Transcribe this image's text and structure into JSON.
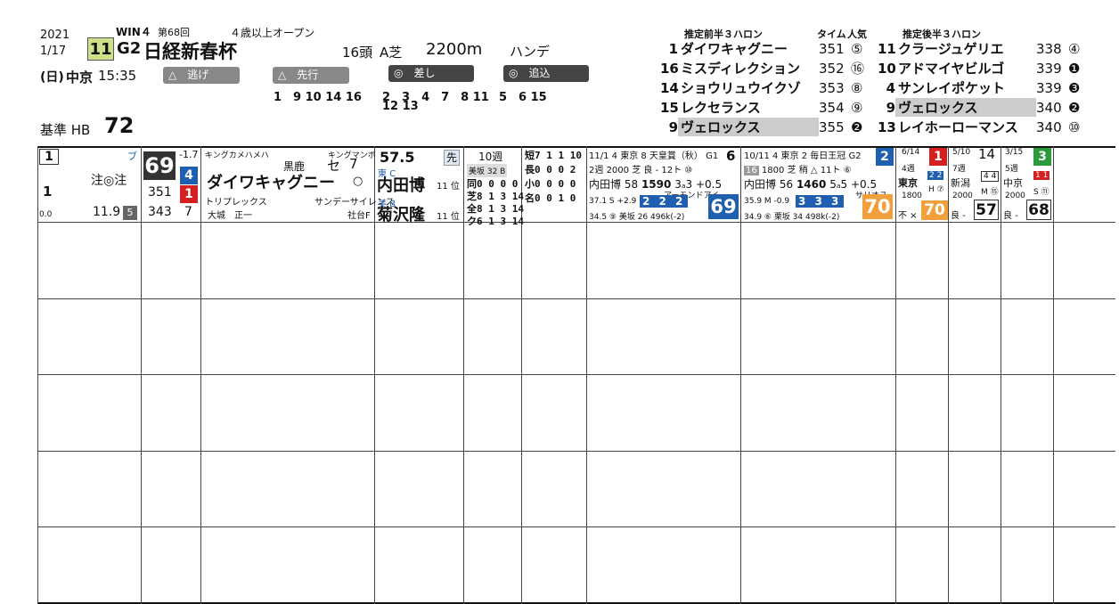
{
  "race": {
    "year": "2021",
    "date": "1/17",
    "weekday": "(日)",
    "venue": "中京",
    "time": "15:35",
    "win": "WIN４",
    "kai": "第68回",
    "race_no": "11",
    "grade": "G2",
    "name": "日経新春杯",
    "cond": "４歳以上オープン",
    "heads": "16頭",
    "course": "A芝",
    "distance": "2200m",
    "handicap": "ハンデ",
    "base_label": "基準 HB",
    "base_value": "72"
  },
  "pace": {
    "labels": [
      "△　逃げ",
      "△　先行",
      "◎　差し",
      "◎　追込"
    ],
    "nige": "1　9 10 14 16",
    "senko1": "2　3　4　7　8 11",
    "senko2": "12 13",
    "sashi": "5　6 15"
  },
  "front3f": {
    "title": "推定前半３ハロン",
    "time_label": "タイム",
    "ninki_label": "人気",
    "rows": [
      [
        "1",
        "ダイワキャグニー",
        "351",
        "⑤"
      ],
      [
        "16",
        "ミスディレクション",
        "352",
        "⑯"
      ],
      [
        "14",
        "ショウリュウイクゾ",
        "353",
        "⑧"
      ],
      [
        "15",
        "レクセランス",
        "354",
        "⑨"
      ],
      [
        "9",
        "ヴェロックス",
        "355",
        "❷"
      ]
    ]
  },
  "back3f": {
    "title": "推定後半３ハロン",
    "rows": [
      [
        "11",
        "クラージュゲリエ",
        "338",
        "④"
      ],
      [
        "10",
        "アドマイヤビルゴ",
        "339",
        "❶"
      ],
      [
        "4",
        "サンレイポケット",
        "339",
        "❸"
      ],
      [
        "9",
        "ヴェロックス",
        "340",
        "❷"
      ],
      [
        "13",
        "レイホーローマンス",
        "340",
        "⑩"
      ]
    ]
  },
  "entry1": {
    "waku": "1",
    "umaban": "1",
    "marks": "注◎注",
    "odds": "11.9",
    "pop": "5",
    "points": "0.0",
    "bu": "ブ",
    "index": "69",
    "idx_diff": "-1.7",
    "idx_sub1": "4",
    "idx_sub2": "1",
    "idx_a": "351",
    "idx_b": "343",
    "idx_rank": "7",
    "sire": "キングカメハメハ",
    "broodsire": "キングマンボ",
    "color": "黒鹿",
    "sex": "セ",
    "age": "7",
    "name": "ダイワキャグニー",
    "dam": "トリプレックス",
    "damsire": "サンデーサイレンス",
    "owner": "大城　正一",
    "farm": "社台F",
    "weight": "57.5",
    "style": "先",
    "stable": "東 C",
    "jockey": "内田博",
    "jrank": "11 位",
    "ebet": "美 B",
    "trainer": "菊沢隆",
    "trank": "11 位",
    "weeks": "10週",
    "trainer_course": "美坂 32 B",
    "stats": [
      [
        "同",
        "0 0 0 0"
      ],
      [
        "短",
        "7 1 1 10"
      ],
      [
        "芝",
        "8 1 3 14"
      ],
      [
        "長",
        "0 0 0 2"
      ],
      [
        "全",
        "8 1 3 14"
      ],
      [
        "小",
        "0 0 0 0"
      ],
      [
        "ク",
        "6 1 3 14"
      ],
      [
        "名",
        "0 0 1 0"
      ]
    ],
    "f1": {
      "date": "11/1",
      "venue": "4 東京",
      "race": "8 天皇賞（秋）",
      "grade": "G1",
      "pos": "6",
      "wk": "2週",
      "dist": "2000",
      "cond": "芝 良",
      "heads": "12ト",
      "pop": "⑩",
      "jockey": "内田博",
      "kg": "58",
      "time": "1590",
      "pass": "3ₐ3",
      "diff": "+0.5",
      "win": "アーモンドアイ",
      "l1": "37.1 S +2.9",
      "lap": "2 2 2",
      "l2": "34.5 ⑨ 美坂 26 496k(-2)",
      "fig": "69"
    },
    "f2": {
      "date": "10/11",
      "venue": "4 東京",
      "race": "2 毎日王冠",
      "grade": "G2",
      "pos": "2",
      "wk": "16",
      "dist": "1800",
      "cond": "芝 稍",
      "heads": "11ト",
      "pop": "⑥",
      "jockey": "内田博",
      "kg": "56",
      "time": "1460",
      "pass": "5ₐ5",
      "diff": "+0.5",
      "win": "サリオス",
      "l1": "35.9 M -0.9",
      "lap": "3 3 3",
      "l2": "34.9 ⑥ 栗坂 34 498k(-2)",
      "fig": "70"
    },
    "f3": {
      "date": "6/14",
      "wk": "4週",
      "venue": "東京",
      "dist": "1800",
      "cond": "不 ×",
      "pos": "1",
      "lap": "2 2",
      "mark": "H ⑦",
      "fig": "70"
    },
    "f4": {
      "date": "5/10",
      "wk": "7週",
      "venue": "新潟",
      "dist": "2000",
      "cond": "良 -",
      "pos": "14",
      "lap": "4 4",
      "mark": "M ⑮",
      "fig": "57"
    },
    "f5": {
      "date": "3/15",
      "wk": "5週",
      "venue": "中京",
      "dist": "2000",
      "cond": "良 -",
      "pos": "3",
      "lap": "1 1",
      "mark": "S ⑪",
      "fig": "68"
    }
  },
  "colors": {
    "red": "#d42020",
    "blue": "#1f5fb0",
    "orange": "#f2a03b",
    "green": "#2a9a3a",
    "yellow": "#f7d36a",
    "cyan": "#9fdce6"
  }
}
